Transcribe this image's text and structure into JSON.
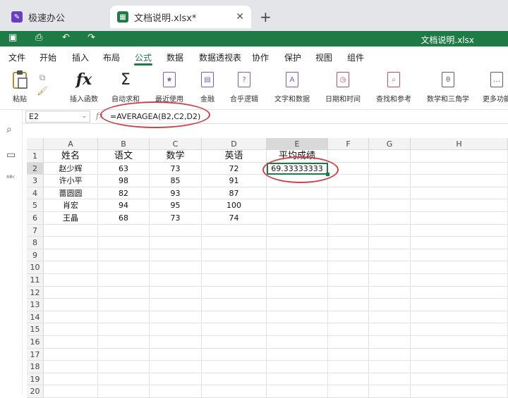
{
  "tabs": [
    {
      "label": "极速办公",
      "icon": "speed-office-icon",
      "color": "#6a3fbf"
    },
    {
      "label": "文档说明.xlsx*",
      "icon": "spreadsheet-icon",
      "color": "#1e7b46"
    }
  ],
  "titlebar": {
    "doc_title": "文档说明.xlsx"
  },
  "menu": [
    "文件",
    "开始",
    "插入",
    "布局",
    "公式",
    "数据",
    "数据透视表",
    "协作",
    "保护",
    "视图",
    "组件"
  ],
  "menu_active": "公式",
  "ribbon": {
    "paste": "粘贴",
    "buttons": [
      "插入函数",
      "自动求和",
      "最近使用",
      "金融",
      "合乎逻辑",
      "文字和数据",
      "日期和时间",
      "查找和参考",
      "数学和三角学",
      "更多功能"
    ]
  },
  "formula_bar": {
    "cell_ref": "E2",
    "fx": "fx",
    "formula": "=AVERAGEA(B2,C2,D2)"
  },
  "columns": [
    "A",
    "B",
    "C",
    "D",
    "E",
    "F",
    "G",
    "H"
  ],
  "row_numbers": [
    "1",
    "2",
    "3",
    "4",
    "5",
    "6",
    "7",
    "8",
    "9",
    "10",
    "11",
    "12",
    "13",
    "14",
    "15",
    "16",
    "17",
    "18",
    "19",
    "20"
  ],
  "table": {
    "headers": [
      "姓名",
      "语文",
      "数学",
      "英语",
      "平均成绩"
    ],
    "rows": [
      [
        "赵少辉",
        "63",
        "73",
        "72",
        "69.33333333"
      ],
      [
        "许小平",
        "98",
        "85",
        "91",
        ""
      ],
      [
        "蔷圆圆",
        "82",
        "93",
        "87",
        ""
      ],
      [
        "肖宏",
        "94",
        "95",
        "100",
        ""
      ],
      [
        "王晶",
        "68",
        "73",
        "74",
        ""
      ]
    ]
  },
  "colors": {
    "accent": "#1e7b46",
    "annotation": "#d0404a"
  }
}
